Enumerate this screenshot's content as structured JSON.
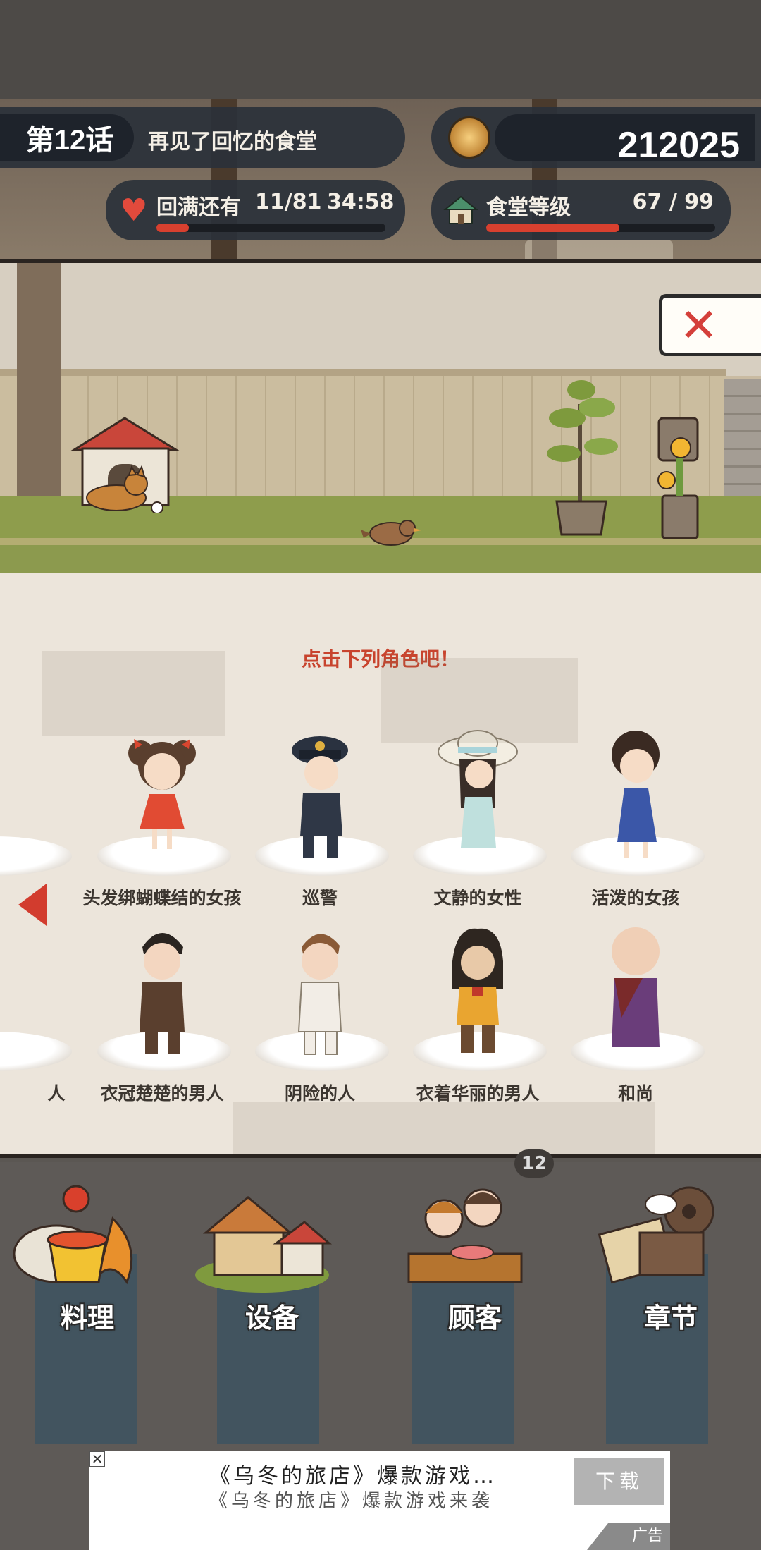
{
  "header": {
    "chapter_number": "第12话",
    "chapter_title": "再见了回忆的食堂",
    "coins": "212025",
    "refill_label": "回满还有",
    "refill_count": "11/81",
    "refill_timer": "34:58",
    "refill_progress": 0.14,
    "level_label": "食堂等级",
    "level_count": "67 / 99",
    "level_progress": 0.58
  },
  "panel": {
    "close_symbol": "✕",
    "prompt": "点击下列角色吧！",
    "row1_edge_name": "",
    "row1": [
      {
        "name": "头发绑蝴蝶结的女孩",
        "icon": "girl-with-bows"
      },
      {
        "name": "巡警",
        "icon": "policeman"
      },
      {
        "name": "文静的女性",
        "icon": "quiet-woman-hat"
      },
      {
        "name": "活泼的女孩",
        "icon": "lively-girl"
      }
    ],
    "row2_edge_name": "人",
    "row2": [
      {
        "name": "衣冠楚楚的男人",
        "icon": "dapper-man"
      },
      {
        "name": "阴险的人",
        "icon": "sinister-man"
      },
      {
        "name": "衣着华丽的男人",
        "icon": "flashy-man"
      },
      {
        "name": "和尚",
        "icon": "monk"
      }
    ]
  },
  "nav": [
    {
      "label": "料理",
      "icon": "cooking-pot-icon"
    },
    {
      "label": "设备",
      "icon": "house-equipment-icon"
    },
    {
      "label": "顾客",
      "icon": "customers-icon"
    },
    {
      "label": "章节",
      "icon": "film-projector-icon"
    }
  ],
  "table_number": "12",
  "ad": {
    "close_symbol": "✕",
    "title": "《乌冬的旅店》爆款游戏…",
    "subtitle": "《乌冬的旅店》爆款游戏来袭",
    "button": "下载",
    "badge": "广告"
  },
  "colors": {
    "accent_red": "#d23c2e",
    "pill_dark": "#2a313a",
    "nav_column": "#3f5361"
  }
}
